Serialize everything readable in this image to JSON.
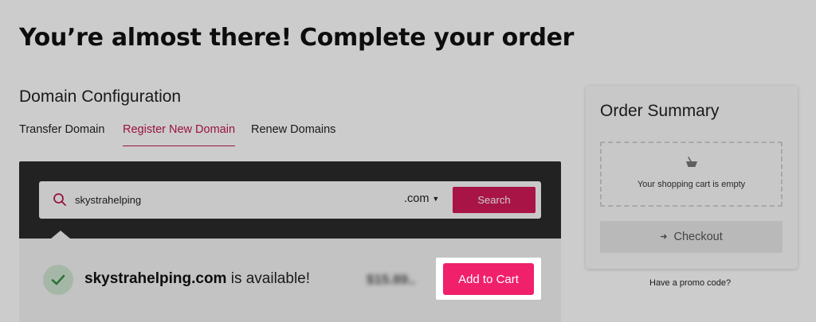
{
  "header": {
    "title": "You’re almost there! Complete your order"
  },
  "domain_config": {
    "title": "Domain Configuration",
    "tabs": [
      {
        "label": "Transfer Domain",
        "active": false
      },
      {
        "label": "Register New Domain",
        "active": true
      },
      {
        "label": "Renew Domains",
        "active": false
      }
    ],
    "search": {
      "value": "skystrahelping",
      "placeholder": "",
      "tld": ".com",
      "button_label": "Search"
    },
    "result": {
      "domain": "skystrahelping.com",
      "status_text": "is available!",
      "price": "$15.89",
      "price_suffix": "..",
      "add_to_cart_label": "Add to Cart"
    }
  },
  "order_summary": {
    "title": "Order Summary",
    "empty_text": "Your shopping cart is empty",
    "checkout_label": "Checkout",
    "promo_link": "Have a promo code?"
  },
  "colors": {
    "accent": "#d41a58",
    "add_to_cart": "#f0206a",
    "dark_panel": "#2b2b2b",
    "success_badge": "#cfe6d1",
    "success_check": "#3a8f4b"
  },
  "icons": {
    "search": "search-icon",
    "check": "check-icon",
    "basket": "basket-icon",
    "checkout": "arrow-right-icon",
    "dropdown": "chevron-down-icon"
  }
}
